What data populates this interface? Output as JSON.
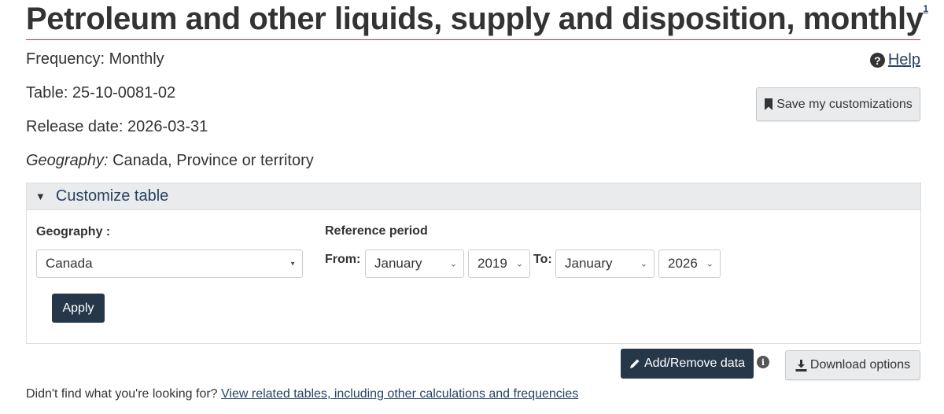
{
  "header": {
    "title": "Petroleum and other liquids, supply and disposition, monthly",
    "footnote": "1"
  },
  "meta": {
    "frequency": "Frequency: Monthly",
    "table": "Table: 25-10-0081-02",
    "release_date": "Release date: 2026-03-31",
    "geography_label": "Geography:",
    "geography_value": " Canada, Province or territory"
  },
  "help": {
    "icon": "question-circle-icon",
    "label": "Help"
  },
  "save_button": {
    "icon": "bookmark-icon",
    "label": "Save my customizations"
  },
  "customize": {
    "toggle_label": "Customize table",
    "geography_label": "Geography :",
    "geography_selected": "Canada",
    "reference_period_label": "Reference period",
    "from_label": "From:",
    "from_month": "January",
    "from_year": "2019",
    "to_label": "To:",
    "to_month": "January",
    "to_year": "2026",
    "apply_label": "Apply"
  },
  "actions": {
    "add_remove_label": "Add/Remove data",
    "download_label": "Download options"
  },
  "related": {
    "prompt": "Didn't find what you're looking for?",
    "link_text": "View related tables, including other calculations and frequencies"
  },
  "colors": {
    "accent_rule": "#af3c43",
    "link": "#284162",
    "dark_button": "#26374a"
  }
}
